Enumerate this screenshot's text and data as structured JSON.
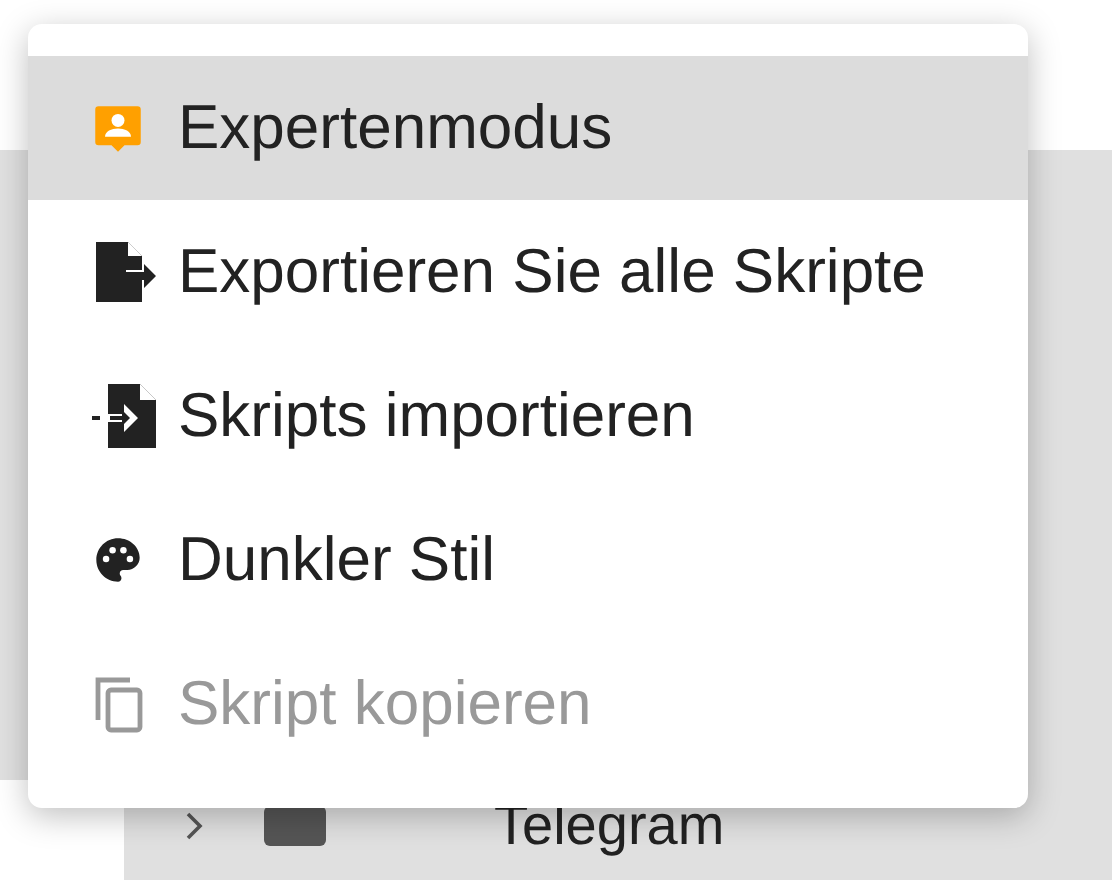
{
  "menu": {
    "items": [
      {
        "kind": "expert",
        "label": "Expertenmodus",
        "selected": true,
        "disabled": false
      },
      {
        "kind": "export",
        "label": "Exportieren Sie alle Skripte",
        "selected": false,
        "disabled": false
      },
      {
        "kind": "import",
        "label": "Skripts importieren",
        "selected": false,
        "disabled": false
      },
      {
        "kind": "palette",
        "label": "Dunkler Stil",
        "selected": false,
        "disabled": false
      },
      {
        "kind": "copy",
        "label": "Skript kopieren",
        "selected": false,
        "disabled": true
      }
    ]
  },
  "tree": {
    "items": [
      {
        "label": "Telegram",
        "expanded": false
      }
    ]
  }
}
